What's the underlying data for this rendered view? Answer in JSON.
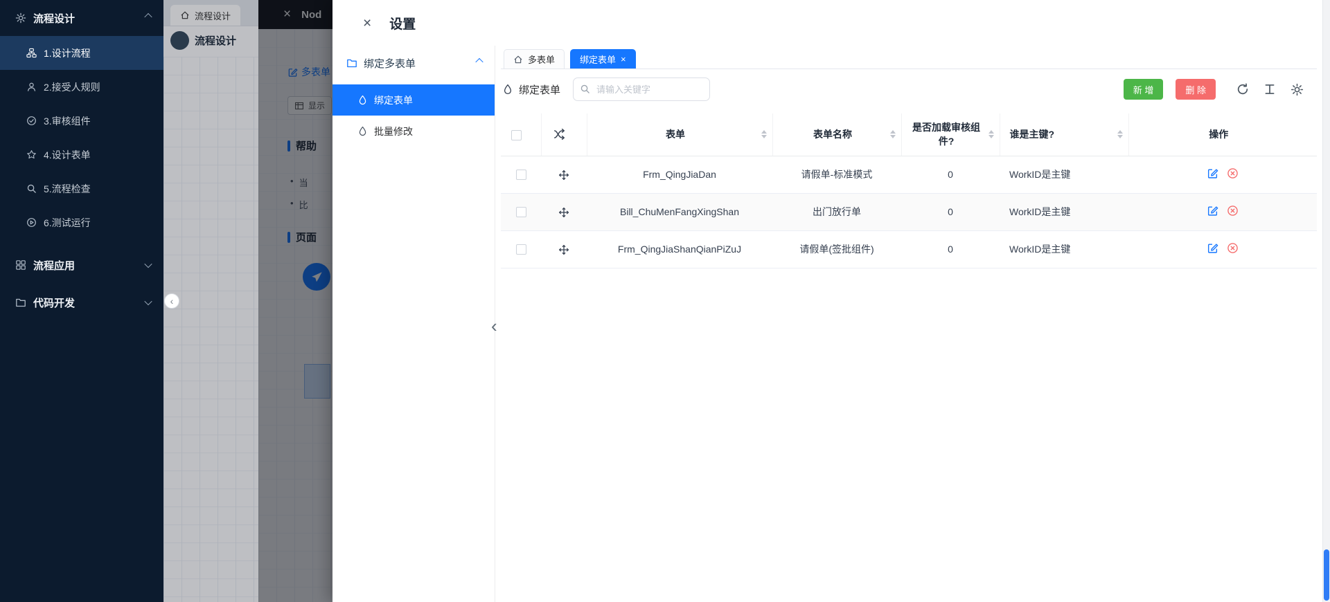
{
  "colors": {
    "primary": "#1677ff",
    "sidebar_bg": "#0c1b2e",
    "sidebar_active_bg": "#1c3a5f",
    "add_green": "#4cb648",
    "delete_red": "#f56c6c",
    "scrollbar_thumb": "#2f7cf6"
  },
  "icons": {
    "close": "×",
    "bullet": "•",
    "collapse_left": "‹"
  },
  "sidebar": {
    "group_design": {
      "label": "流程设计",
      "icon": "gear-icon"
    },
    "items": [
      {
        "label": "1.设计流程",
        "icon": "flow-icon",
        "active": true
      },
      {
        "label": "2.接受人规则",
        "icon": "user-icon",
        "active": false
      },
      {
        "label": "3.审核组件",
        "icon": "check-circle-icon",
        "active": false
      },
      {
        "label": "4.设计表单",
        "icon": "star-icon",
        "active": false
      },
      {
        "label": "5.流程检查",
        "icon": "magnifier-icon",
        "active": false
      },
      {
        "label": "6.测试运行",
        "icon": "play-icon",
        "active": false
      }
    ],
    "group_app": {
      "label": "流程应用",
      "icon": "apps-icon"
    },
    "group_code": {
      "label": "代码开发",
      "icon": "folder-icon"
    }
  },
  "background_page": {
    "tab_label": "流程设计",
    "brand_label": "流程设计",
    "drawer_title": "Nod",
    "panel": {
      "link_label": "多表单",
      "show_button_label": "显示",
      "help_title": "帮助",
      "bullets": [
        "当",
        "比"
      ],
      "page_title": "页面"
    }
  },
  "settings": {
    "title": "设置",
    "nav": {
      "group_label": "绑定多表单",
      "items": [
        {
          "label": "绑定表单",
          "active": true
        },
        {
          "label": "批量修改",
          "active": false
        }
      ]
    },
    "tabs": [
      {
        "label": "多表单",
        "active": false
      },
      {
        "label": "绑定表单",
        "active": true,
        "closable": true
      }
    ],
    "toolbar": {
      "section_label": "绑定表单",
      "search_placeholder": "请输入关键字",
      "add_label": "新 增",
      "delete_label": "删 除"
    },
    "table": {
      "headers": {
        "form": "表单",
        "name": "表单名称",
        "load_audit": "是否加载审核组件?",
        "pk": "谁是主键?",
        "actions": "操作"
      },
      "rows": [
        {
          "form": "Frm_QingJiaDan",
          "name": "请假单-标准模式",
          "load_audit": "0",
          "pk": "WorkID是主键"
        },
        {
          "form": "Bill_ChuMenFangXingShan",
          "name": "出门放行单",
          "load_audit": "0",
          "pk": "WorkID是主键"
        },
        {
          "form": "Frm_QingJiaShanQianPiZuJ",
          "name": "请假单(签批组件)",
          "load_audit": "0",
          "pk": "WorkID是主键"
        }
      ]
    }
  }
}
